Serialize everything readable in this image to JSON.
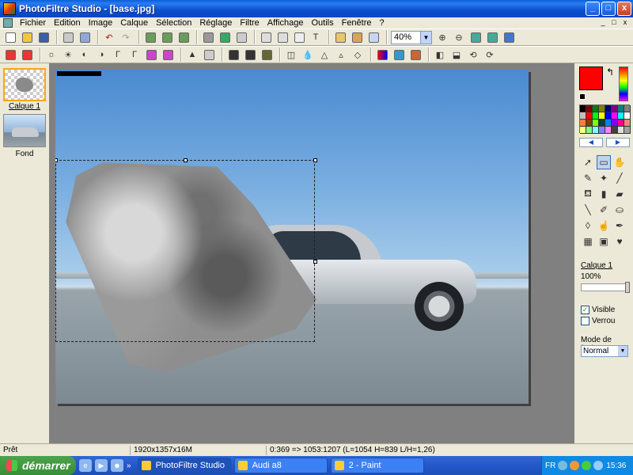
{
  "window": {
    "title": "PhotoFiltre Studio - [base.jpg]",
    "buttons": {
      "minimize": "_",
      "maximize": "□",
      "close": "x"
    }
  },
  "menubar": {
    "items": [
      "Fichier",
      "Edition",
      "Image",
      "Calque",
      "Sélection",
      "Réglage",
      "Filtre",
      "Affichage",
      "Outils",
      "Fenêtre",
      "?"
    ],
    "mdi_buttons": [
      "_",
      "□",
      "x"
    ]
  },
  "toolbar": {
    "zoom_value": "40%",
    "zoom_dropdown_icon": "▼"
  },
  "layers_panel": {
    "layers": [
      {
        "label": "Calque 1",
        "selected": true
      },
      {
        "label": "Fond",
        "selected": false
      }
    ]
  },
  "tools_panel": {
    "foreground_color": "#ff0000",
    "background_color": "#000000",
    "swap_icon": "↰",
    "palette_nav_left": "◀",
    "palette_nav_right": "▶",
    "layer_name": "Calque 1",
    "opacity": "100%",
    "visible_label": "Visible",
    "visible_checked": true,
    "lock_label": "Verrou",
    "lock_checked": false,
    "blend_mode_label": "Mode de fusion",
    "blend_mode": "Normal",
    "blend_dropdown_icon": "▼",
    "visible_check_mark": "✓"
  },
  "statusbar": {
    "status": "Prêt",
    "image_info": "1920x1357x16M",
    "selection_info": "0:369 => 1053:1207 (L=1054  H=839  L/H=1,26)"
  },
  "taskbar": {
    "start_label": "démarrer",
    "quick_launch_more": "»",
    "tasks": [
      {
        "label": "PhotoFiltre Studio",
        "active": true
      },
      {
        "label": "Audi a8",
        "active": false
      },
      {
        "label": "2 - Paint",
        "active": false
      }
    ],
    "language": "FR",
    "clock": "15:36"
  }
}
